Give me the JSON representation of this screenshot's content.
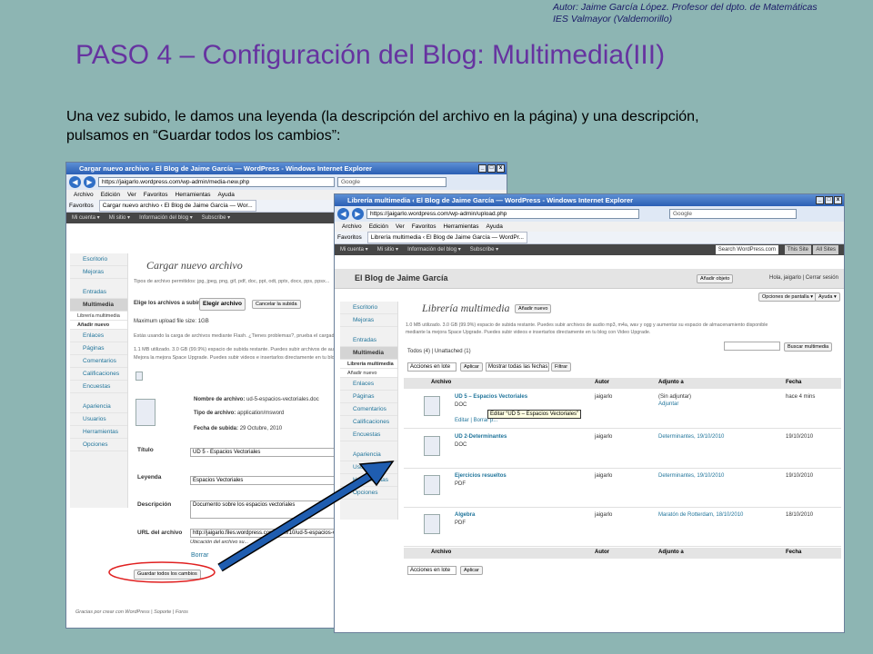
{
  "author": {
    "line1": "Autor: Jaime García López. Profesor del dpto. de Matemáticas",
    "line2": "IES Valmayor (Valdemorillo)"
  },
  "title": "PASO 4 – Configuración del Blog: Multimedia(III)",
  "intro": "Una vez subido, le damos una leyenda (la descripción del archivo en la página) y una descripción, pulsamos en “Guardar todos los cambios”:",
  "win1": {
    "window_title": "Cargar nuevo archivo ‹ El Blog de Jaime García — WordPress - Windows Internet Explorer",
    "url": "https://jaigarlo.wordpress.com/wp-admin/media-new.php",
    "search": "Google",
    "menu": [
      "Archivo",
      "Edición",
      "Ver",
      "Favoritos",
      "Herramientas",
      "Ayuda"
    ],
    "favorites": "Favoritos",
    "tab": "Cargar nuevo archivo ‹ El Blog de Jaime García — Wor...",
    "wpbar": [
      "Mi cuenta ▾",
      "Mi sitio ▾",
      "Información del blog ▾",
      "Subscribe ▾"
    ],
    "sidebar": [
      "Escritorio",
      "Mejoras",
      "Entradas",
      "Multimedia",
      "Librería multimedia",
      "Añadir nuevo",
      "Enlaces",
      "Páginas",
      "Comentarios",
      "Calificaciones",
      "Encuestas",
      "Apariencia",
      "Usuarios",
      "Herramientas",
      "Opciones"
    ],
    "heading": "Cargar nuevo archivo",
    "allowed": "Tipos de archivo permitidos: jpg, jpeg, png, gif, pdf, doc, ppt, odt, pptx, docx, pps, ppsx...",
    "choose": "Elige los archivos a subir",
    "choose_btn": "Elegir archivo",
    "cancel_btn": "Cancelar la subida",
    "max": "Maximum upload file size: 1GB",
    "flash": "Estás usando la carga de archivos mediante Flash. ¿Tienes problemas?, prueba el cargador...",
    "space": "1.1 MB utilizado. 3.0 GB (99.9%) espacio de subida restante. Puedes subir archivos de audio...",
    "space2": "Mejora la mejora Space Upgrade. Puedes subir videos e insertarlos directamente en tu blog...",
    "file_name_label": "Nombre de archivo:",
    "file_name": "ud-5-espacios-vectoriales.doc",
    "file_type_label": "Tipo de archivo:",
    "file_type": "application/msword",
    "upload_date_label": "Fecha de subida:",
    "upload_date": "29 Octubre, 2010",
    "label_title": "Título",
    "value_title": "UD 5 - Espacios Vectoriales",
    "label_caption": "Leyenda",
    "value_caption": "Espacios Vectoriales",
    "label_desc": "Descripción",
    "value_desc": "Documento sobre los espacios vectoriales",
    "label_url": "URL del archivo",
    "value_url": "http://jaigarlo.files.wordpress.com/2010/10/ud-5-espacios-ve...",
    "url_note": "Ubicación del archivo su...",
    "delete": "Borrar",
    "save_btn": "Guardar todos los cambios",
    "footer": "Gracias por crear con WordPress | Soporte | Foros"
  },
  "win2": {
    "window_title": "Librería multimedia ‹ El Blog de Jaime García — WordPress - Windows Internet Explorer",
    "url": "https://jaigarlo.wordpress.com/wp-admin/upload.php",
    "search": "Google",
    "menu": [
      "Archivo",
      "Edición",
      "Ver",
      "Favoritos",
      "Herramientas",
      "Ayuda"
    ],
    "favorites": "Favoritos",
    "tab": "Librería multimedia ‹ El Blog de Jaime García — WordPr...",
    "wpbar": [
      "Mi cuenta ▾",
      "Mi sitio ▾",
      "Información del blog ▾",
      "Subscribe ▾"
    ],
    "wp_search": "Search WordPress.com",
    "this_site": "This Site",
    "all_sites": "All Sites",
    "blog_name": "El Blog de Jaime García",
    "add_object": "Añadir objeto",
    "greeting": "Hola, jaigarlo | Cerrar sesión",
    "screen_opts": "Opciones de pantalla ▾",
    "help": "Ayuda ▾",
    "sidebar": [
      "Escritorio",
      "Mejoras",
      "Entradas",
      "Multimedia",
      "Librería multimedia",
      "Añadir nuevo",
      "Enlaces",
      "Páginas",
      "Comentarios",
      "Calificaciones",
      "Encuestas",
      "Apariencia",
      "Usuarios",
      "Herramientas",
      "Opciones"
    ],
    "heading": "Librería multimedia",
    "add_new_btn": "Añadir nuevo",
    "space": "1.0 MB utilizado. 3.0 GB (99.9%) espacio de subida restante. Puedes subir archivos de audio mp3, m4a, wav y ogg y aumentar su espacio de almacenamiento disponible",
    "space2": "mediante la mejora Space Upgrade. Puedes subir videos e insertarlos directamente en tu blog con Video Upgrade.",
    "filter": "Todos (4) | Unattached (1)",
    "search_btn": "Buscar multimedia",
    "bulk": "Acciones en lote",
    "apply": "Aplicar",
    "dates": "Mostrar todas las fechas",
    "filter_btn": "Filtrar",
    "columns": [
      "Archivo",
      "Autor",
      "Adjunto a",
      "Fecha"
    ],
    "rows": [
      {
        "name": "UD 5 – Espacios Vectoriales",
        "type": "DOC",
        "author": "jaigarlo",
        "attached": "(Sin adjuntar)",
        "attached2": "Adjuntar",
        "date": "hace 4 mins",
        "actions": "Editar | Borrar p..."
      },
      {
        "name": "UD 2-Determinantes",
        "type": "DOC",
        "author": "jaigarlo",
        "attached": "Determinantes, 19/10/2010",
        "attached2": "",
        "date": "19/10/2010",
        "actions": ""
      },
      {
        "name": "Ejercicios resueltos",
        "type": "PDF",
        "author": "jaigarlo",
        "attached": "Determinantes, 19/10/2010",
        "attached2": "",
        "date": "19/10/2010",
        "actions": ""
      },
      {
        "name": "Algebra",
        "type": "PDF",
        "author": "jaigarlo",
        "attached": "Maratón de Rotterdam, 18/10/2010",
        "attached2": "",
        "date": "18/10/2010",
        "actions": ""
      }
    ],
    "tooltip": "Editar “UD 5 – Espacios Vectoriales”"
  },
  "colors": {
    "background": "#8db5b3",
    "title": "#6633a0",
    "arrow": "#1f5db0",
    "highlight": "#e02020"
  }
}
